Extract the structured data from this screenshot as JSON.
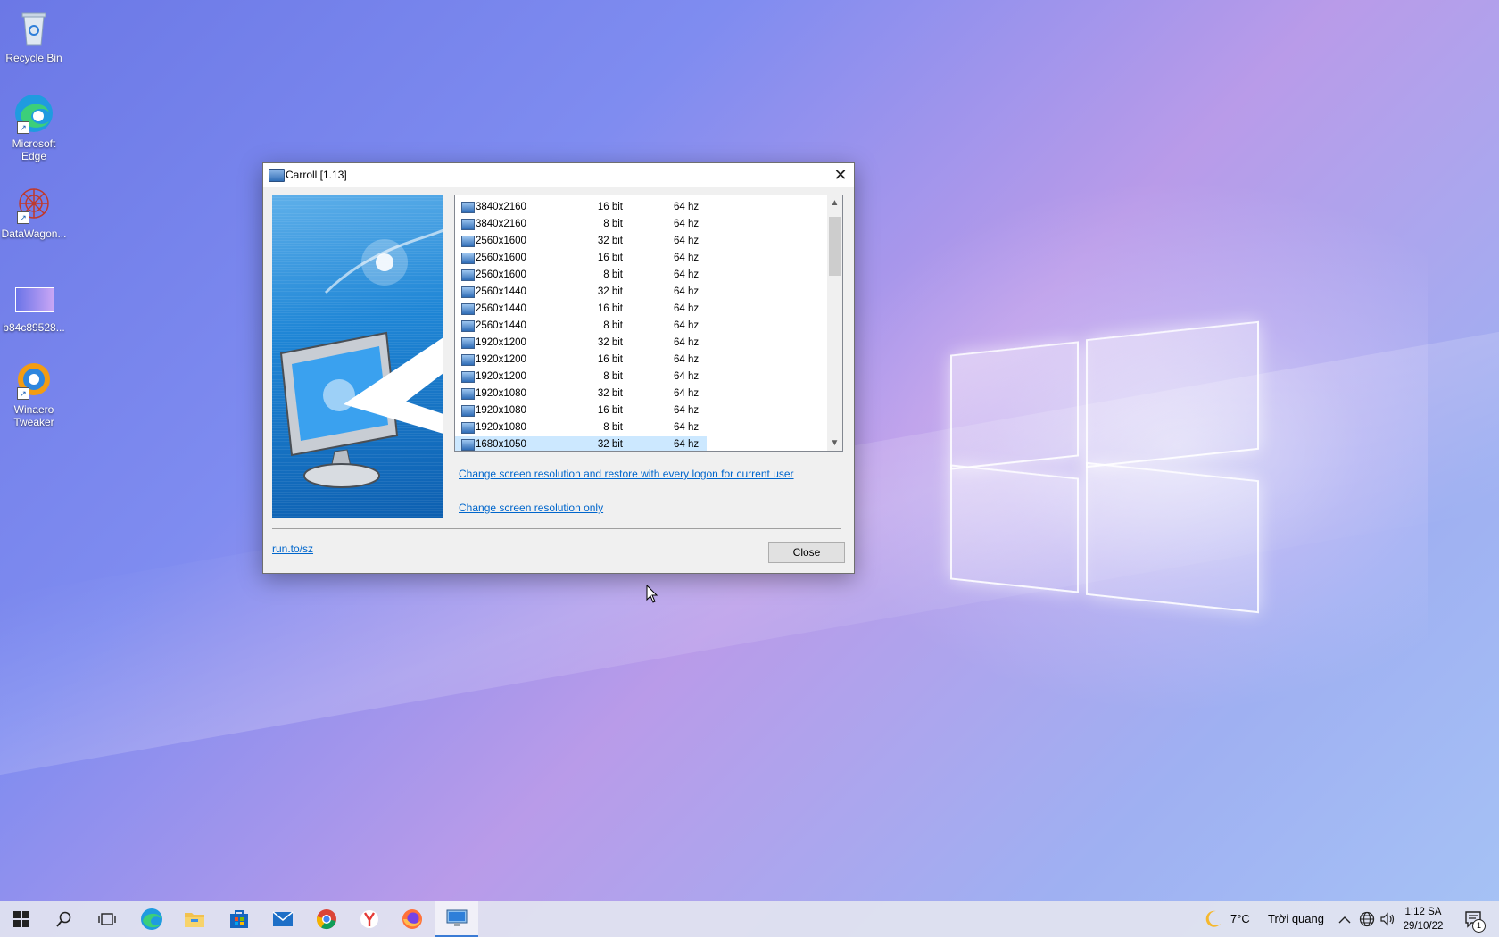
{
  "desktop": {
    "icons": [
      {
        "label": "Recycle Bin",
        "icon": "recycle-bin-icon"
      },
      {
        "label": "Microsoft Edge",
        "icon": "edge-icon"
      },
      {
        "label": "DataWagon...",
        "icon": "datawagon-icon"
      },
      {
        "label": "b84c89528...",
        "icon": "image-file-icon"
      },
      {
        "label": "Winaero Tweaker",
        "icon": "winaero-tweaker-icon"
      }
    ]
  },
  "dialog": {
    "title": "Carroll [1.13]",
    "close_glyph": "✕",
    "modes": [
      {
        "resolution": "3840x2160",
        "depth": "16 bit",
        "refresh": "64 hz"
      },
      {
        "resolution": "3840x2160",
        "depth": "8 bit",
        "refresh": "64 hz"
      },
      {
        "resolution": "2560x1600",
        "depth": "32 bit",
        "refresh": "64 hz"
      },
      {
        "resolution": "2560x1600",
        "depth": "16 bit",
        "refresh": "64 hz"
      },
      {
        "resolution": "2560x1600",
        "depth": "8 bit",
        "refresh": "64 hz"
      },
      {
        "resolution": "2560x1440",
        "depth": "32 bit",
        "refresh": "64 hz"
      },
      {
        "resolution": "2560x1440",
        "depth": "16 bit",
        "refresh": "64 hz"
      },
      {
        "resolution": "2560x1440",
        "depth": "8 bit",
        "refresh": "64 hz"
      },
      {
        "resolution": "1920x1200",
        "depth": "32 bit",
        "refresh": "64 hz"
      },
      {
        "resolution": "1920x1200",
        "depth": "16 bit",
        "refresh": "64 hz"
      },
      {
        "resolution": "1920x1200",
        "depth": "8 bit",
        "refresh": "64 hz"
      },
      {
        "resolution": "1920x1080",
        "depth": "32 bit",
        "refresh": "64 hz"
      },
      {
        "resolution": "1920x1080",
        "depth": "16 bit",
        "refresh": "64 hz"
      },
      {
        "resolution": "1920x1080",
        "depth": "8 bit",
        "refresh": "64 hz"
      },
      {
        "resolution": "1680x1050",
        "depth": "32 bit",
        "refresh": "64 hz",
        "selected": true
      }
    ],
    "link_restore": "Change screen resolution and restore with every logon for current user",
    "link_only": "Change screen resolution only",
    "footer_link": "run.to/sz",
    "close_button": "Close"
  },
  "taskbar": {
    "apps": [
      "start-icon",
      "search-icon",
      "task-view-icon",
      "edge-icon",
      "file-explorer-icon",
      "store-icon",
      "mail-icon",
      "chrome-icon",
      "yandex-icon",
      "firefox-icon",
      "carroll-icon"
    ],
    "weather_temp": "7°C",
    "weather_desc": "Trời quang",
    "time": "1:12 SA",
    "date": "29/10/22",
    "notification_count": "1"
  }
}
